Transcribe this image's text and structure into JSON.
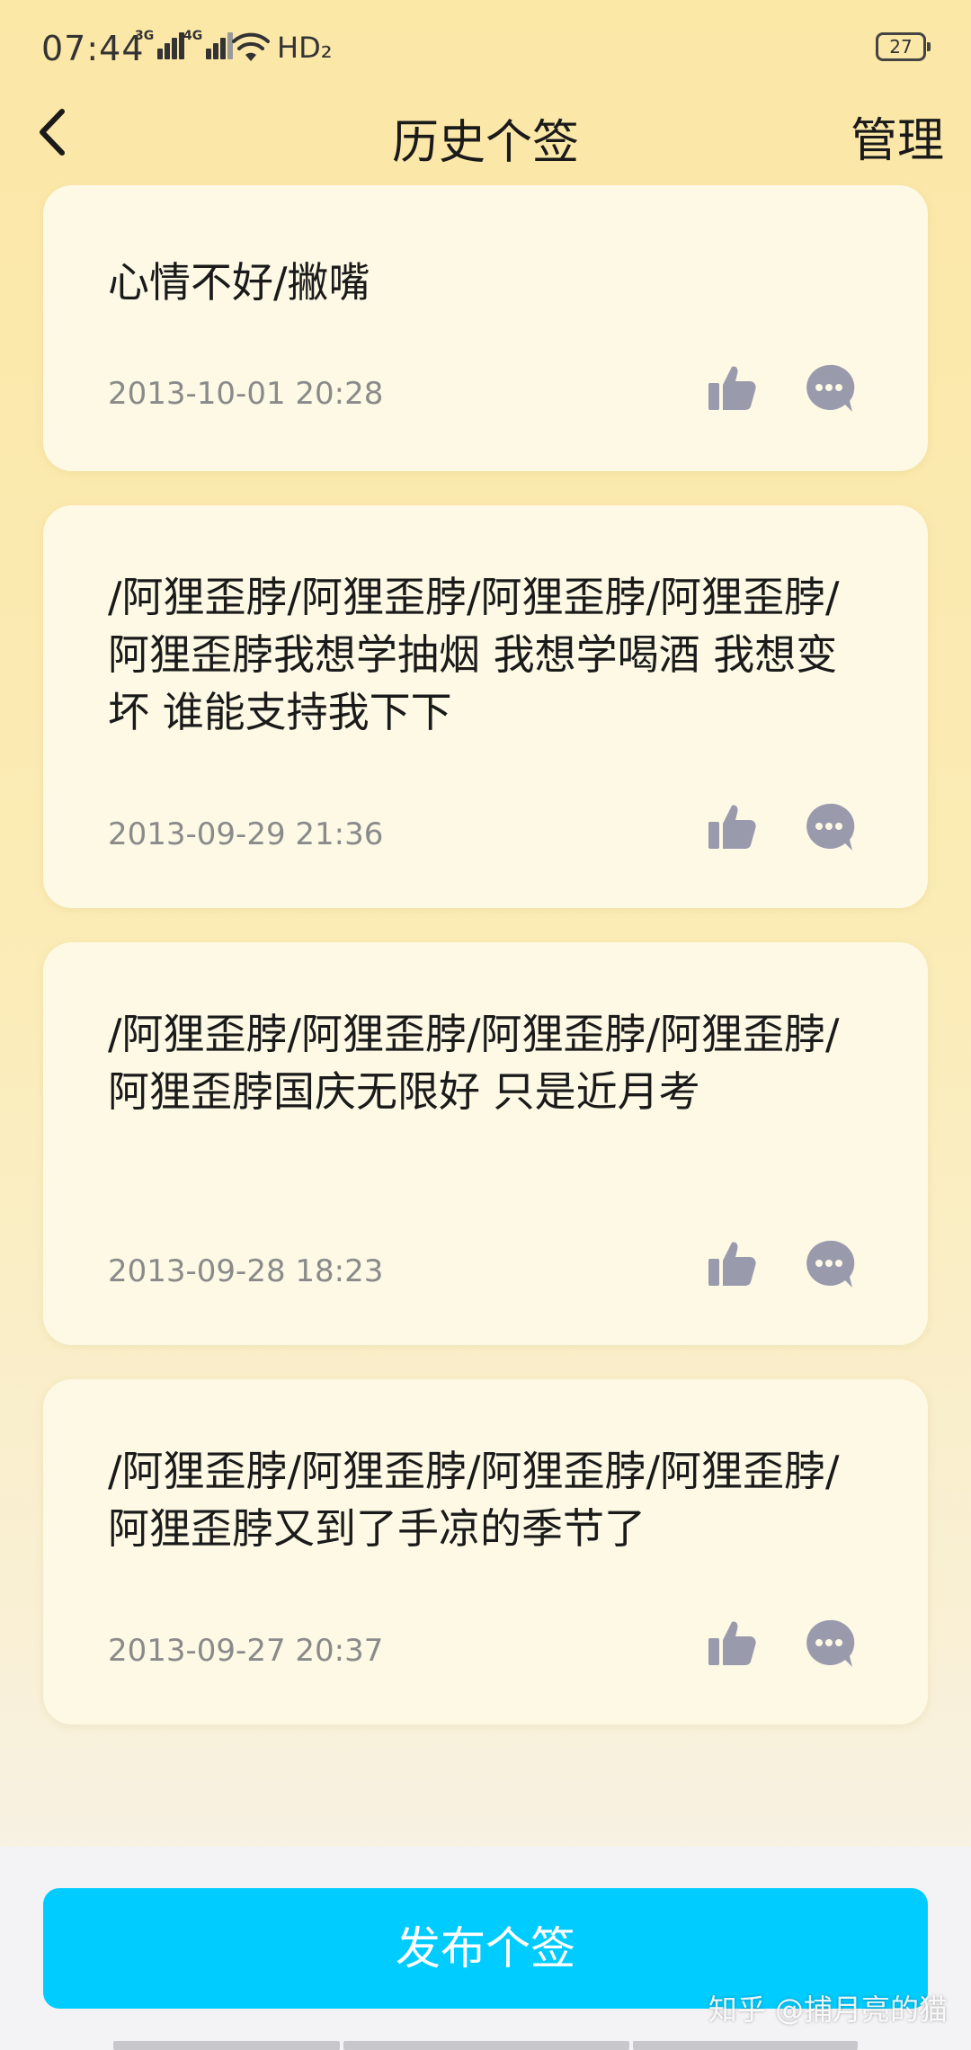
{
  "status_bar": {
    "time": "07:44",
    "network_1": "3G",
    "network_2": "4G",
    "hd": "HD₂",
    "battery": "27"
  },
  "header": {
    "title": "历史个签",
    "manage_label": "管理"
  },
  "cards": [
    {
      "text": "心情不好/撇嘴",
      "date": "2013-10-01 20:28"
    },
    {
      "text": "/阿狸歪脖/阿狸歪脖/阿狸歪脖/阿狸歪脖/阿狸歪脖我想学抽烟 我想学喝酒 我想变坏  谁能支持我下下",
      "date": "2013-09-29 21:36"
    },
    {
      "text": "/阿狸歪脖/阿狸歪脖/阿狸歪脖/阿狸歪脖/阿狸歪脖国庆无限好  只是近月考",
      "date": "2013-09-28 18:23"
    },
    {
      "text": "/阿狸歪脖/阿狸歪脖/阿狸歪脖/阿狸歪脖/阿狸歪脖又到了手凉的季节了",
      "date": "2013-09-27 20:37"
    }
  ],
  "icons": {
    "like": "thumbs-up-icon",
    "comment": "comment-bubble-icon",
    "back": "chevron-left-icon"
  },
  "colors": {
    "accent": "#00ccff",
    "icon": "#9a9aad",
    "date_text": "#8a8a8a"
  },
  "bottom": {
    "publish_label": "发布个签",
    "watermark": "知乎 @捕月亮的猫"
  }
}
